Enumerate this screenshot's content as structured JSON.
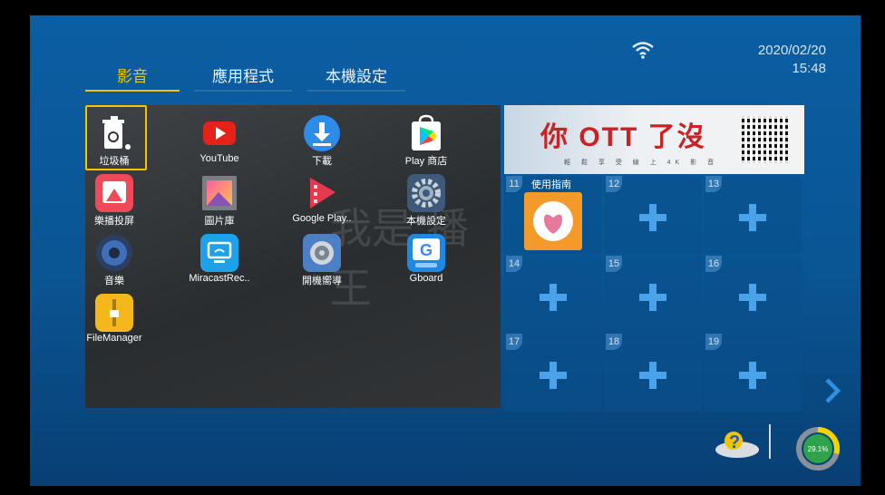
{
  "status": {
    "date": "2020/02/20",
    "time": "15:48",
    "wifi_icon": "wifi-icon"
  },
  "tabs": [
    {
      "label": "影音",
      "active": true
    },
    {
      "label": "應用程式",
      "active": false
    },
    {
      "label": "本機設定",
      "active": false
    }
  ],
  "apps": [
    {
      "label": "垃圾桶",
      "icon": "trash-icon"
    },
    {
      "label": "YouTube",
      "icon": "youtube-icon"
    },
    {
      "label": "下載",
      "icon": "download-icon"
    },
    {
      "label": "Play 商店",
      "icon": "play-store-icon"
    },
    {
      "label": "樂播投屏",
      "icon": "lebo-cast-icon"
    },
    {
      "label": "圖片庫",
      "icon": "gallery-icon"
    },
    {
      "label": "Google Play..",
      "icon": "google-play-movies-icon"
    },
    {
      "label": "本機設定",
      "icon": "settings-gear-icon"
    },
    {
      "label": "音樂",
      "icon": "music-speaker-icon"
    },
    {
      "label": "MiracastRec..",
      "icon": "miracast-icon"
    },
    {
      "label": "開機嚮導",
      "icon": "setup-wizard-icon"
    },
    {
      "label": "Gboard",
      "icon": "gboard-icon"
    },
    {
      "label": "FileManager",
      "icon": "file-manager-icon"
    }
  ],
  "background_watermark": "我是 播 王",
  "banner": {
    "headline": "你 OTT 了沒",
    "subline": "輕 鬆 享 受 線 上 4K 影 音"
  },
  "slots": [
    {
      "num": "11",
      "label": "使用指南",
      "filled": true
    },
    {
      "num": "12",
      "label": "",
      "filled": false
    },
    {
      "num": "13",
      "label": "",
      "filled": false
    },
    {
      "num": "14",
      "label": "",
      "filled": false
    },
    {
      "num": "15",
      "label": "",
      "filled": false
    },
    {
      "num": "16",
      "label": "",
      "filled": false
    },
    {
      "num": "17",
      "label": "",
      "filled": false
    },
    {
      "num": "18",
      "label": "",
      "filled": false
    },
    {
      "num": "19",
      "label": "",
      "filled": false
    }
  ],
  "memory": {
    "percent_label": "29.1%",
    "percent": 29.1
  },
  "colors": {
    "accent": "#f5c400",
    "background": "#0a5593",
    "plus": "#4aa2e8"
  }
}
